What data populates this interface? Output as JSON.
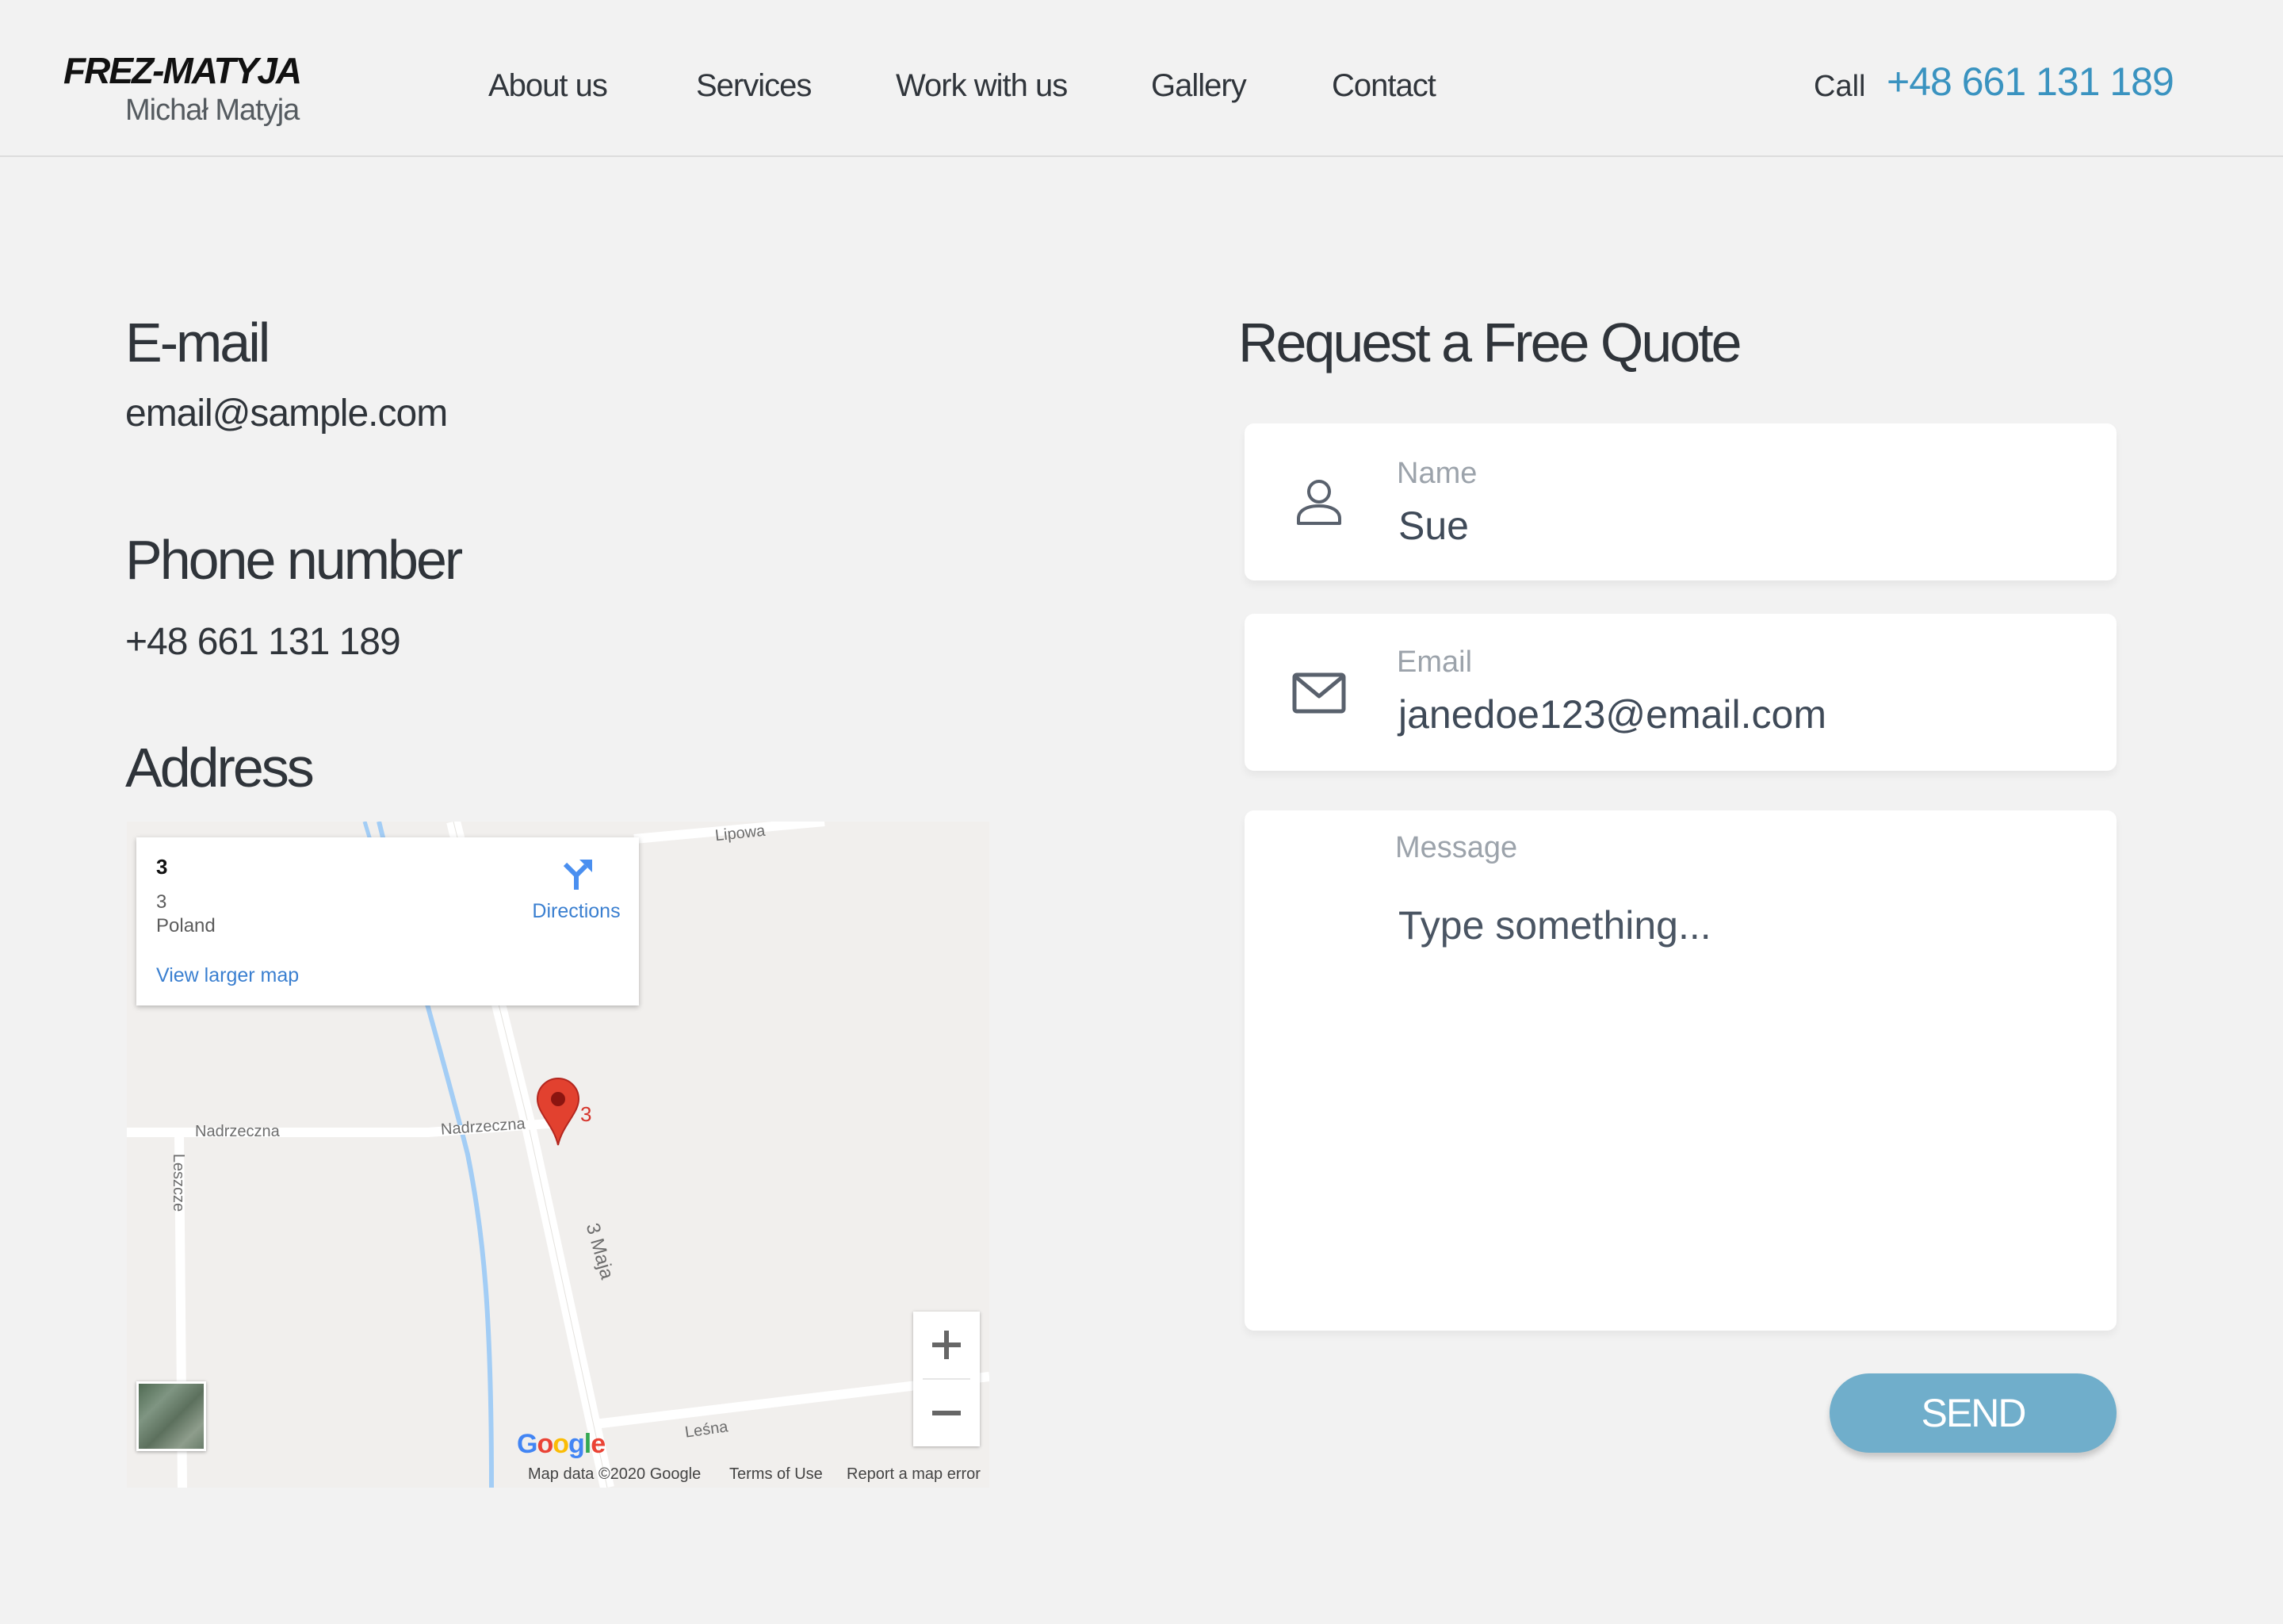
{
  "header": {
    "logo_title": "FREZ-MATYJA",
    "logo_subtitle": "Michał Matyja",
    "nav": [
      {
        "label": "About us"
      },
      {
        "label": "Services"
      },
      {
        "label": "Work with us"
      },
      {
        "label": "Gallery"
      },
      {
        "label": "Contact"
      }
    ],
    "call_label": "Call",
    "call_number": "+48 661 131 189"
  },
  "contact": {
    "email_heading": "E-mail",
    "email_value": "email@sample.com",
    "phone_heading": "Phone number",
    "phone_value": "+48 661 131 189",
    "address_heading": "Address"
  },
  "map": {
    "info_title": "3",
    "info_line1": "3",
    "info_line2": "Poland",
    "view_larger": "View larger map",
    "directions": "Directions",
    "marker_label": "3",
    "roads": {
      "lipowa": "Lipowa",
      "nadrzeczna_left": "Nadrzeczna",
      "nadrzeczna_right": "Nadrzeczna",
      "leszcze": "Leszcze",
      "maja": "3 Maja",
      "lesna": "Leśna"
    },
    "google": "Google",
    "footer": {
      "data": "Map data ©2020 Google",
      "terms": "Terms of Use",
      "report": "Report a map error"
    }
  },
  "form": {
    "heading": "Request a Free Quote",
    "name_label": "Name",
    "name_value": "Sue",
    "email_label": "Email",
    "email_value": "janedoe123@email.com",
    "message_label": "Message",
    "message_placeholder": "Type something...",
    "send": "SEND"
  },
  "colors": {
    "accent": "#3a93c0",
    "send_button": "#70aecb",
    "background": "#f2f2f2",
    "marker": "#e2412f"
  }
}
